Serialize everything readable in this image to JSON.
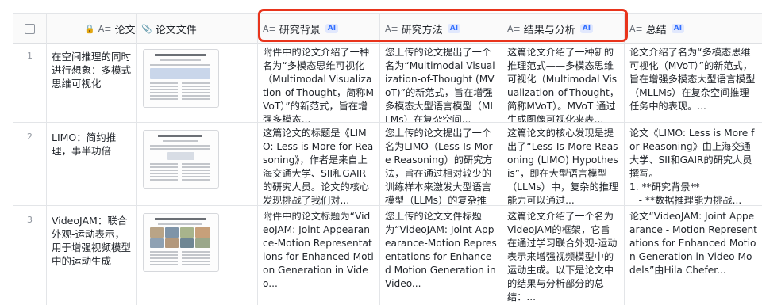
{
  "columns": {
    "title": "论文标题",
    "file": "论文文件",
    "background": "研究背景",
    "method": "研究方法",
    "results": "结果与分析",
    "summary": "总结",
    "ai_badge": "AI"
  },
  "rows": [
    {
      "num": "1",
      "title": "在空间推理的同时进行想象：多模式思维可视化",
      "background": "附件中的论文介绍了一种名为“多模态思维可视化（Multimodal Visualization-of-Thought，简称MVoT）”的新范式，旨在增强多模态...",
      "method": "您上传的论文提出了一个名为“Multimodal Visualization-of-Thought (MVoT)”的新范式，旨在增强多模态大型语言模型（MLLMs）在复杂空间...",
      "results": "这篇论文介绍了一种新的推理范式——多模态思维可视化（Multimodal Visualization-of-Thought，简称MVoT）。MVoT 通过生成图像可视化来表...",
      "summary": "论文介绍了名为“多模态思维可视化（MVoT）”的新范式，旨在增强多模态大型语言模型（MLLMs）在复杂空间推理任务中的表现。..."
    },
    {
      "num": "2",
      "title": "LIMO：简约推理，事半功倍",
      "background": "这篇论文的标题是《LIMO: Less is More for Reasoning》，作者是来自上海交通大学、SII和GAIR的研究人员。论文的核心发现挑战了我们对...",
      "method": "您上传的论文提出了一个名为LIMO（Less-Is-More Reasoning）的研究方法，旨在通过相对较少的训练样本来激发大型语言模型（LLMs）的复杂推理...",
      "results": "这篇论文的核心发现是提出了“Less-Is-More Reasoning (LIMO) Hypothesis”，即在大型语言模型（LLMs）中，复杂的推理能力可以通过...",
      "summary": "论文《LIMO: Less is More for Reasoning》由上海交通大学、SII和GAIR的研究人员撰写。\n1. **研究背景**\n   - **数据推理能力挑战..."
    },
    {
      "num": "3",
      "title": "VideoJAM：联合外观-运动表示，用于增强视频模型中的运动生成",
      "background": "附件中的论文标题为“VideoJAM: Joint Appearance-Motion Representations for Enhanced Motion Generation in Video...",
      "method": "您上传的论文文件标题为“VideoJAM: Joint Appearance-Motion Representations for Enhanced Motion Generation in Video...",
      "results": "这篇论文介绍了一个名为VideoJAM的框架，它旨在通过学习联合外观-运动表示来增强视频模型中的运动生成。以下是论文中的结果与分析部分的总结：...",
      "summary": "论文“VideoJAM: Joint Appearance - Motion Representations for Enhanced Motion Generation in Video Models”由Hila Chefer..."
    }
  ],
  "colors": {
    "accent": "#3370ff",
    "highlight_border": "#e8341c",
    "grid_line": "#e3e5e8"
  },
  "icons": {
    "checkbox": "checkbox-icon",
    "lock": "lock-icon",
    "text_field": "text-field-icon",
    "attachment": "paperclip-icon",
    "ai_text_field": "ai-text-field-icon"
  }
}
